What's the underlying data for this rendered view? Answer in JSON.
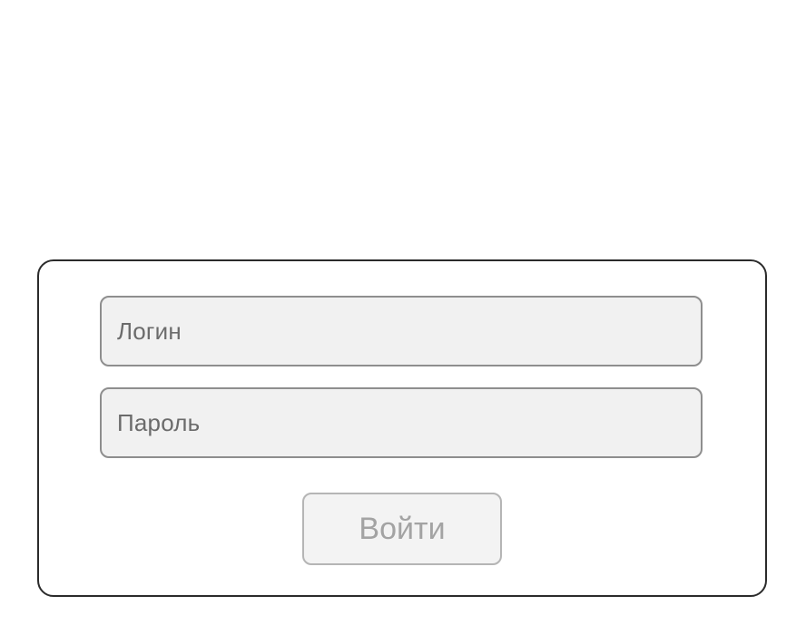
{
  "login_form": {
    "login_field": {
      "placeholder": "Логин",
      "value": ""
    },
    "password_field": {
      "placeholder": "Пароль",
      "value": ""
    },
    "submit_label": "Войти"
  },
  "colors": {
    "card_border": "#2b2b2b",
    "field_border": "#8e8e8e",
    "field_background": "#f1f1f1",
    "placeholder_text": "#6b6b6b",
    "button_border": "#b5b5b5",
    "button_text": "#a3a3a3"
  }
}
